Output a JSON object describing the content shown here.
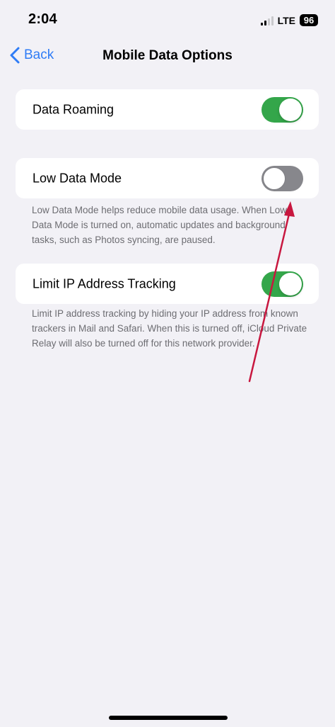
{
  "status_bar": {
    "time": "2:04",
    "network": "LTE",
    "battery": "96",
    "icons": [
      "signal-icon",
      "battery-icon"
    ]
  },
  "nav": {
    "back_label": "Back",
    "title": "Mobile Data Options",
    "icons": [
      "chevron-left-icon"
    ]
  },
  "settings": {
    "data_roaming": {
      "label": "Data Roaming",
      "enabled": true
    },
    "low_data_mode": {
      "label": "Low Data Mode",
      "enabled": false,
      "footnote": "Low Data Mode helps reduce mobile data usage. When Low Data Mode is turned on, automatic updates and background tasks, such as Photos syncing, are paused."
    },
    "limit_ip_tracking": {
      "label": "Limit IP Address Tracking",
      "enabled": true,
      "footnote": "Limit IP address tracking by hiding your IP address from known trackers in Mail and Safari. When this is turned off, iCloud Private Relay will also be turned off for this network provider."
    }
  },
  "colors": {
    "toggle_on": "#34a64a",
    "toggle_off": "#87878c",
    "accent": "#2f7cf6",
    "background": "#f2f1f6",
    "annotation_arrow": "#c8173f"
  }
}
